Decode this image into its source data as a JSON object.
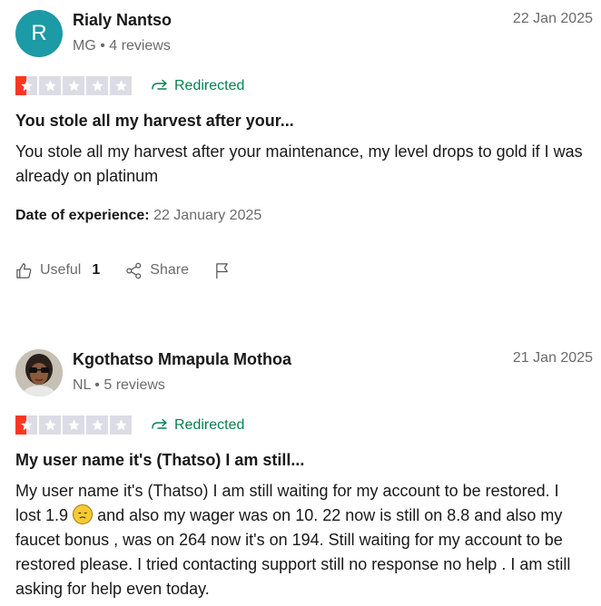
{
  "reviews": [
    {
      "avatar_letter": "R",
      "name": "Rialy Nantso",
      "meta": "MG • 4 reviews",
      "date": "22 Jan 2025",
      "rating": 1,
      "redirected_label": "Redirected",
      "title": "You stole all my harvest after your...",
      "body": "You stole all my harvest after your maintenance, my level drops to gold if I was already on platinum",
      "experience_label": "Date of experience:",
      "experience_date": "22 January 2025",
      "useful_label": "Useful",
      "useful_count": "1",
      "share_label": "Share"
    },
    {
      "name": "Kgothatso Mmapula Mothoa",
      "meta": "NL • 5 reviews",
      "date": "21 Jan 2025",
      "rating": 1,
      "redirected_label": "Redirected",
      "title": "My user name it's (Thatso) I am still...",
      "body_part1": "My user name it's (Thatso) I am still waiting for my account to be restored. I lost 1.9",
      "body_part2": "and also my wager was on 10. 22 now is still on 8.8 and also my faucet bonus , was on 264 now it's on 194. Still waiting for my account to be restored please. I tried contacting support still no response no help . I am still asking for help even today."
    }
  ],
  "colors": {
    "star_filled": "#ff3722",
    "star_empty": "#dcdce6",
    "redirected": "#04824f",
    "avatar_bg": "#1c9aa6"
  },
  "icons": {
    "redirect": "redirect-arrow-icon",
    "thumb": "thumbs-up-icon",
    "share": "share-icon",
    "flag": "flag-icon",
    "star": "star-icon",
    "emoji": "disappointed-face-emoji"
  }
}
